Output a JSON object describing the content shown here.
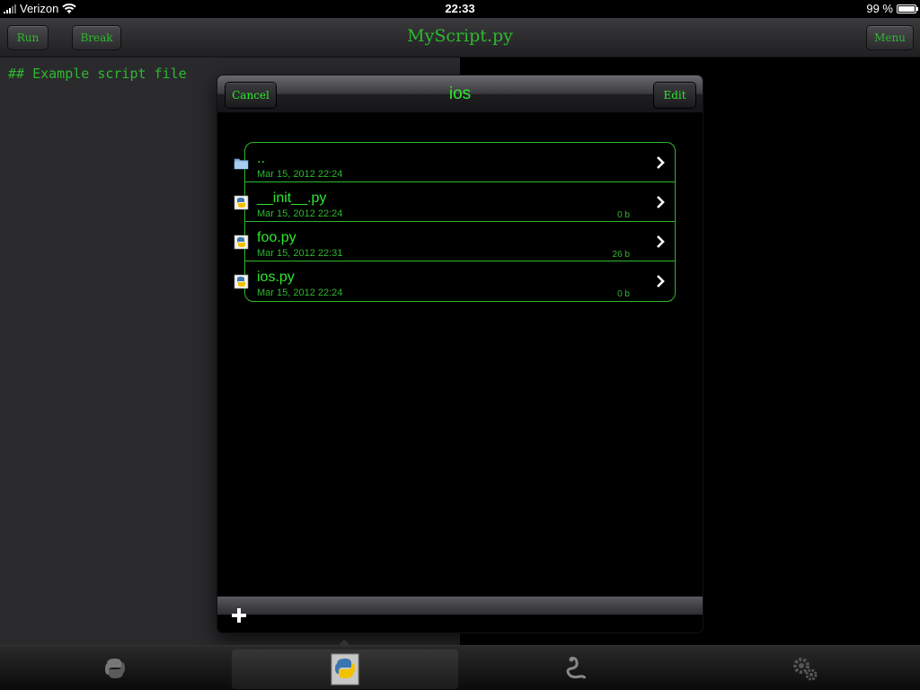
{
  "status_bar": {
    "carrier": "Verizon",
    "time": "22:33",
    "battery": "99 %",
    "battery_level": 0.99
  },
  "toolbar": {
    "run_label": "Run",
    "break_label": "Break",
    "title": "MyScript.py",
    "menu_label": "Menu"
  },
  "editor": {
    "content": "## Example script file"
  },
  "popover": {
    "cancel_label": "Cancel",
    "title": "ios",
    "edit_label": "Edit",
    "files": [
      {
        "name": "..",
        "date": "Mar 15, 2012 22:24",
        "size": "",
        "icon": "folder-icon"
      },
      {
        "name": "__init__.py",
        "date": "Mar 15, 2012 22:24",
        "size": "0 b",
        "icon": "python-file-icon"
      },
      {
        "name": "foo.py",
        "date": "Mar 15, 2012 22:31",
        "size": "26 b",
        "icon": "python-file-icon"
      },
      {
        "name": "ios.py",
        "date": "Mar 15, 2012 22:24",
        "size": "0 b",
        "icon": "python-file-icon"
      }
    ]
  },
  "tab_bar": {
    "tabs": [
      {
        "icon": "python-logo-icon",
        "active": false
      },
      {
        "icon": "python-file-icon",
        "active": true
      },
      {
        "icon": "snake-icon",
        "active": false
      },
      {
        "icon": "gears-icon",
        "active": false
      }
    ]
  },
  "colors": {
    "accent_green": "#2ee82e",
    "editor_bg": "#2a2a2d",
    "popover_bg": "#000000"
  }
}
